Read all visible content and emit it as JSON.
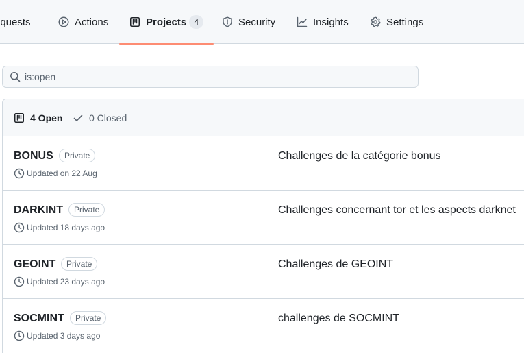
{
  "nav": {
    "tabs": [
      {
        "label": "equests",
        "icon": "pull-request-icon"
      },
      {
        "label": "Actions",
        "icon": "play-icon"
      },
      {
        "label": "Projects",
        "icon": "project-icon",
        "counter": "4",
        "selected": true
      },
      {
        "label": "Security",
        "icon": "shield-icon"
      },
      {
        "label": "Insights",
        "icon": "graph-icon"
      },
      {
        "label": "Settings",
        "icon": "gear-icon"
      }
    ],
    "accent_color": "#fd8c73"
  },
  "search": {
    "value": "is:open",
    "icon": "search-icon"
  },
  "filters": {
    "open_label": "4 Open",
    "closed_label": "0 Closed"
  },
  "projects": [
    {
      "title": "BONUS",
      "visibility": "Private",
      "updated": "Updated on 22 Aug",
      "description": "Challenges de la catégorie bonus"
    },
    {
      "title": "DARKINT",
      "visibility": "Private",
      "updated": "Updated 18 days ago",
      "description": "Challenges concernant tor et les aspects darknet"
    },
    {
      "title": "GEOINT",
      "visibility": "Private",
      "updated": "Updated 23 days ago",
      "description": "Challenges de GEOINT"
    },
    {
      "title": "SOCMINT",
      "visibility": "Private",
      "updated": "Updated 3 days ago",
      "description": "challenges de SOCMINT"
    }
  ]
}
